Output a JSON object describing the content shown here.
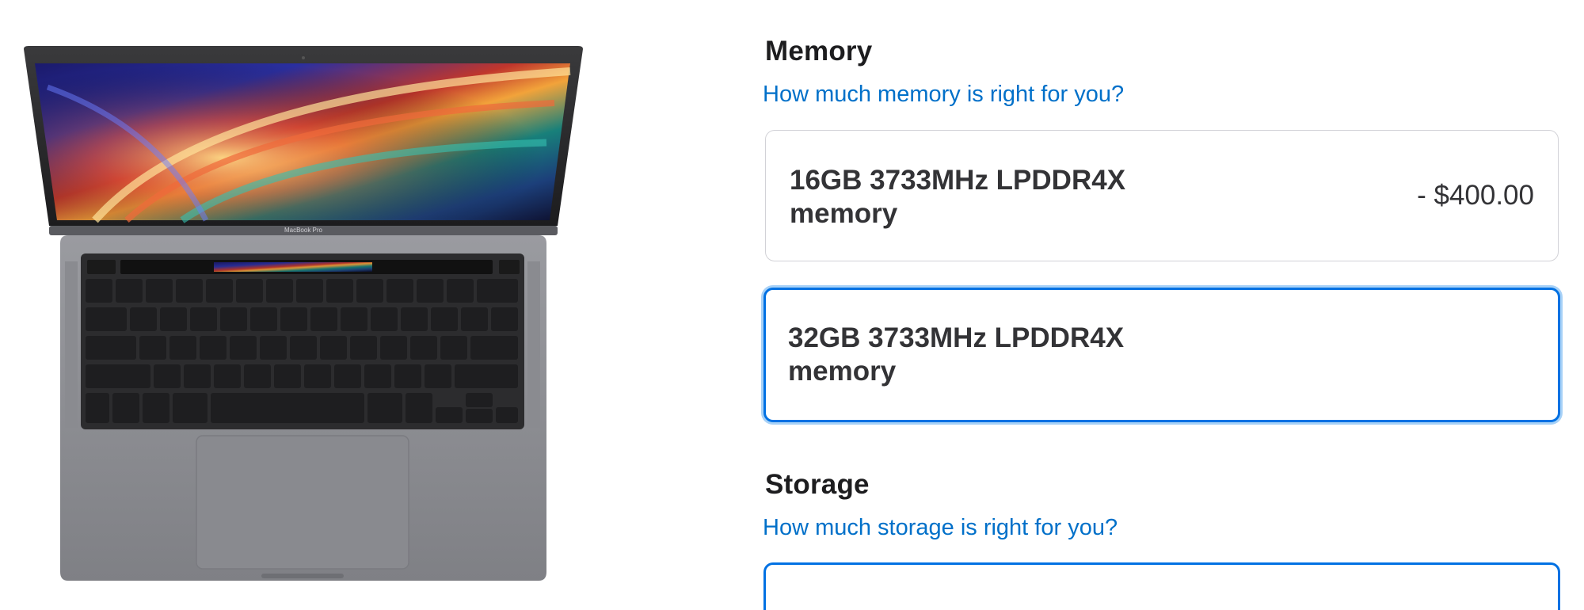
{
  "product": {
    "image_icon": "laptop-icon",
    "screen_brand": "MacBook Pro"
  },
  "memory": {
    "title": "Memory",
    "help_link": "How much memory is right for you?",
    "options": [
      {
        "label_line1": "16GB 3733MHz LPDDR4X",
        "label_line2": "memory",
        "price": "- $400.00",
        "selected": false
      },
      {
        "label_line1": "32GB 3733MHz LPDDR4X",
        "label_line2": "memory",
        "price": "",
        "selected": true
      }
    ]
  },
  "storage": {
    "title": "Storage",
    "help_link": "How much storage is right for you?"
  },
  "colors": {
    "link": "#0070c9",
    "selected_border": "#0071e3",
    "selected_halo": "#a7d1f7",
    "option_border": "#d2d2d7",
    "laptop_body": "#8e8f94"
  }
}
